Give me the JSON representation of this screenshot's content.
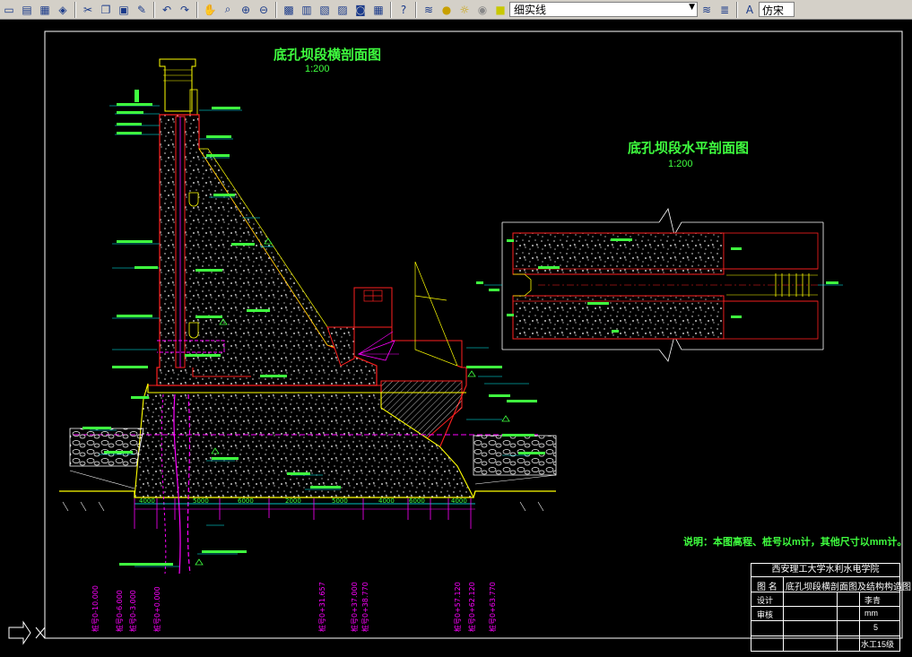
{
  "toolbar": {
    "linetype_value": "细实线",
    "font_value": "仿宋",
    "icons": [
      "new-icon",
      "open-icon",
      "save-icon",
      "print-icon",
      "cut-icon",
      "copy-icon",
      "paste-icon",
      "matchprop-icon",
      "undo-icon",
      "redo-icon",
      "pan-icon",
      "zoom-realtime-icon",
      "zoom-window-icon",
      "zoom-previous-icon",
      "properties-icon",
      "designcenter-icon",
      "toolpalette-icon",
      "sheetset-icon",
      "markup-icon",
      "calculator-icon",
      "help-icon",
      "layers-icon",
      "layer-state-icons",
      "text-style-icon"
    ]
  },
  "drawing": {
    "section_title": "底孔坝段横剖面图",
    "section_scale": "1:200",
    "plan_title": "底孔坝段水平剖面图",
    "plan_scale": "1:200",
    "note": "说明：本图高程、桩号以m计，其他尺寸以mm计。",
    "dims_bottom": [
      "4000",
      "5000",
      "6000",
      "2000",
      "5000",
      "4000",
      "6000",
      "4000"
    ],
    "stations": [
      "桩号0-10.000",
      "桩号0-6.000",
      "桩号0-3.000",
      "桩号0+0.000",
      "桩号0+31.657",
      "桩号0+37.000",
      "桩号0+38.770",
      "桩号0+57.120",
      "桩号0+62.120",
      "桩号0+63.770"
    ],
    "title_block": {
      "school": "西安理工大学水利水电学院",
      "label_name": "图 名",
      "drawing_name": "底孔坝段横剖面图及结构构造图",
      "rows": [
        {
          "left": "设计",
          "mid": "",
          "right": "李青"
        },
        {
          "left": "审核",
          "mid": "",
          "right": "mm"
        },
        {
          "left": "",
          "mid": "",
          "right": "5"
        },
        {
          "left": "",
          "mid": "",
          "right": "水工15级"
        }
      ]
    }
  },
  "colors": {
    "green": "#3fff3f",
    "yellow": "#ffff00",
    "red": "#ff2020",
    "cyan": "#00ffff",
    "magenta": "#ff00ff",
    "white": "#ffffff"
  }
}
